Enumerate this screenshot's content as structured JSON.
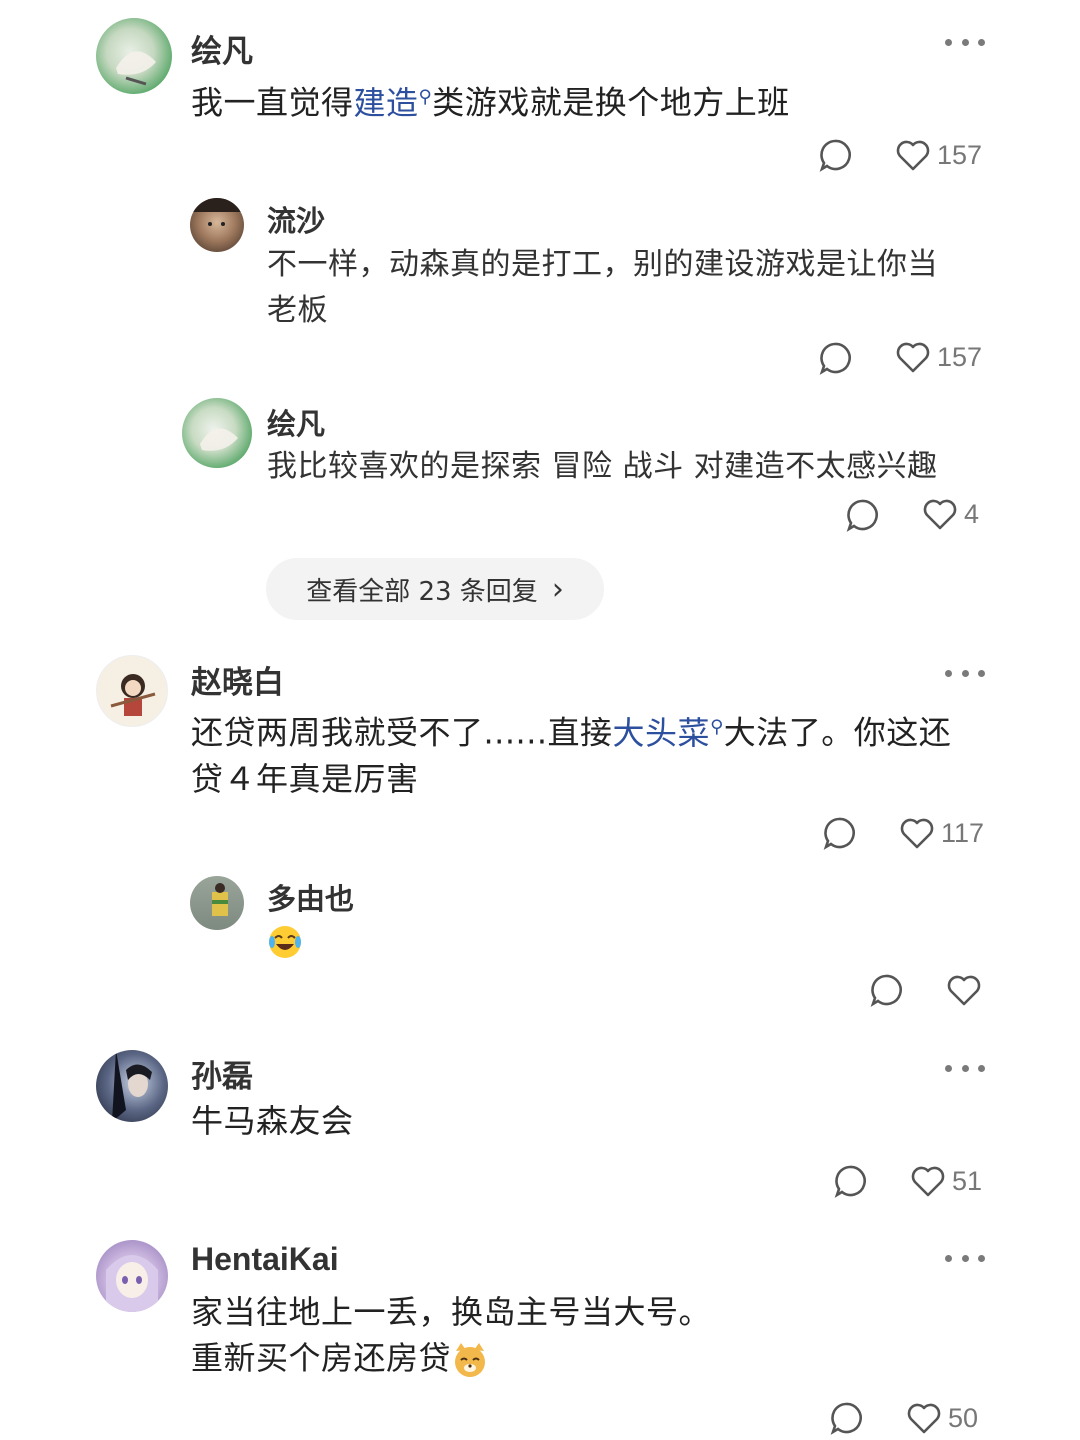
{
  "comments": [
    {
      "user": "绘凡",
      "text_pre": "我一直觉得",
      "link": "建造",
      "text_post": "类游戏就是换个地方上班",
      "likes": "157",
      "replies": [
        {
          "user": "流沙",
          "text_line1": "不一样，动森真的是打工，别的建设游戏是让你当",
          "text_line2": "老板",
          "likes": "157"
        },
        {
          "user": "绘凡",
          "text": "我比较喜欢的是探索 冒险 战斗 对建造不太感兴趣",
          "likes": "4"
        }
      ],
      "view_all": "查看全部 23 条回复",
      "view_all_arrow": "›"
    },
    {
      "user": "赵晓白",
      "text_pre": "还贷两周我就受不了......直接",
      "link": "大头菜",
      "text_post": "大法了。你这还",
      "text_line2": "贷４年真是厉害",
      "likes": "117",
      "replies": [
        {
          "user": "多由也",
          "emoji": "laughing-crying-emoji",
          "likes": ""
        }
      ]
    },
    {
      "user": "孙磊",
      "text": "牛马森友会",
      "likes": "51"
    },
    {
      "user": "HentaiKai",
      "text_line1": "家当往地上一丢，换岛主号当大号。",
      "text_line2": "重新买个房还房贷",
      "emoji": "cat-emoji",
      "likes": "50"
    }
  ],
  "icons": {
    "reply": "reply-bubble-icon",
    "like": "heart-icon",
    "more": "more-dots-icon"
  },
  "colors": {
    "link": "#2c4f9e",
    "count": "#777777",
    "pill_bg": "#f3f3f3"
  }
}
